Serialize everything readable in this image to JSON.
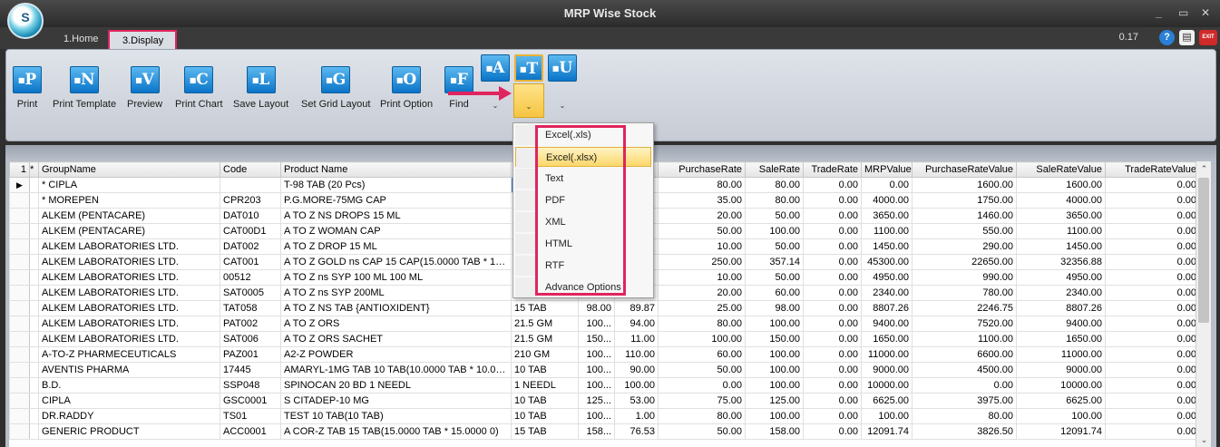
{
  "window": {
    "title": "MRP Wise Stock",
    "logo_text": "S",
    "version": "0.17",
    "minimize": "_",
    "restore": "▭",
    "close": "✕",
    "help_label": "?",
    "note_label": "▤",
    "exit_label": "EXIT"
  },
  "tabs": [
    {
      "label": "1.Home"
    },
    {
      "label": "3.Display"
    }
  ],
  "ribbon": {
    "buttons": [
      {
        "letter": "P",
        "label": "Print"
      },
      {
        "letter": "N",
        "label": "Print Template"
      },
      {
        "letter": "V",
        "label": "Preview"
      },
      {
        "letter": "C",
        "label": "Print Chart"
      },
      {
        "letter": "L",
        "label": "Save Layout"
      },
      {
        "letter": "G",
        "label": "Set Grid Layout"
      },
      {
        "letter": "O",
        "label": "Print Option"
      },
      {
        "letter": "F",
        "label": "Find"
      }
    ],
    "split_buttons": [
      {
        "letter": "A",
        "drop": "⌄"
      },
      {
        "letter": "T",
        "drop": "⌄"
      },
      {
        "letter": "U",
        "drop": "⌄"
      }
    ],
    "icon_small": "■"
  },
  "export_menu": {
    "items": [
      "Excel(.xls)",
      "Excel(.xlsx)",
      "Text",
      "PDF",
      "XML",
      "HTML",
      "RTF",
      "Advance Options"
    ]
  },
  "grid": {
    "row_indicator_header": "1",
    "star_header": "*",
    "current_row_marker": "▶",
    "columns": [
      "GroupName",
      "Code",
      "Product Name",
      "",
      "",
      "",
      "PurchaseRate",
      "SaleRate",
      "TradeRate",
      "MRPValue",
      "PurchaseRateValue",
      "SaleRateValue",
      "TradeRateValue"
    ],
    "rows": [
      [
        "* CIPLA",
        "",
        "T-98 TAB (20 Pcs)",
        "",
        "",
        "",
        "80.00",
        "80.00",
        "0.00",
        "0.00",
        "1600.00",
        "1600.00",
        "0.00"
      ],
      [
        "* MOREPEN",
        "CPR203",
        "P.G.MORE-75MG CAP",
        "",
        "",
        "",
        "35.00",
        "80.00",
        "0.00",
        "4000.00",
        "1750.00",
        "4000.00",
        "0.00"
      ],
      [
        "ALKEM (PENTACARE)",
        "DAT010",
        "A TO Z NS DROPS 15 ML",
        "",
        "",
        "",
        "20.00",
        "50.00",
        "0.00",
        "3650.00",
        "1460.00",
        "3650.00",
        "0.00"
      ],
      [
        "ALKEM (PENTACARE)",
        "CAT00D1",
        "A TO Z WOMAN CAP",
        "",
        "",
        "",
        "50.00",
        "100.00",
        "0.00",
        "1100.00",
        "550.00",
        "1100.00",
        "0.00"
      ],
      [
        "ALKEM LABORATORIES LTD.",
        "DAT002",
        "A TO Z DROP 15 ML",
        "",
        "",
        "",
        "10.00",
        "50.00",
        "0.00",
        "1450.00",
        "290.00",
        "1450.00",
        "0.00"
      ],
      [
        "ALKEM LABORATORIES LTD.",
        "CAT001",
        "A TO Z GOLD ns CAP 15 CAP(15.0000 TAB * 15....",
        "",
        "",
        "",
        "250.00",
        "357.14",
        "0.00",
        "45300.00",
        "22650.00",
        "32356.88",
        "0.00"
      ],
      [
        "ALKEM LABORATORIES LTD.",
        "00512",
        "A TO Z ns SYP 100 ML 100 ML",
        "",
        "",
        "",
        "10.00",
        "50.00",
        "0.00",
        "4950.00",
        "990.00",
        "4950.00",
        "0.00"
      ],
      [
        "ALKEM LABORATORIES LTD.",
        "SAT0005",
        "A TO Z ns SYP 200ML",
        "",
        "",
        "",
        "20.00",
        "60.00",
        "0.00",
        "2340.00",
        "780.00",
        "2340.00",
        "0.00"
      ],
      [
        "ALKEM LABORATORIES LTD.",
        "TAT058",
        "A TO Z NS TAB {ANTIOXIDENT}",
        "15 TAB",
        "98.00",
        "89.87",
        "25.00",
        "98.00",
        "0.00",
        "8807.26",
        "2246.75",
        "8807.26",
        "0.00"
      ],
      [
        "ALKEM LABORATORIES LTD.",
        "PAT002",
        "A TO Z ORS",
        "21.5 GM",
        "100...",
        "94.00",
        "80.00",
        "100.00",
        "0.00",
        "9400.00",
        "7520.00",
        "9400.00",
        "0.00"
      ],
      [
        "ALKEM LABORATORIES LTD.",
        "SAT006",
        "A TO Z ORS SACHET",
        "21.5 GM",
        "150...",
        "11.00",
        "100.00",
        "150.00",
        "0.00",
        "1650.00",
        "1100.00",
        "1650.00",
        "0.00"
      ],
      [
        "A-TO-Z PHARMECEUTICALS",
        "PAZ001",
        "A2-Z POWDER",
        "210 GM",
        "100...",
        "110.00",
        "60.00",
        "100.00",
        "0.00",
        "11000.00",
        "6600.00",
        "11000.00",
        "0.00"
      ],
      [
        "AVENTIS PHARMA",
        "17445",
        "AMARYL-1MG TAB 10 TAB(10.0000 TAB * 10.00...",
        "10 TAB",
        "100...",
        "90.00",
        "50.00",
        "100.00",
        "0.00",
        "9000.00",
        "4500.00",
        "9000.00",
        "0.00"
      ],
      [
        "B.D.",
        "SSP048",
        "SPINOCAN 20 BD 1 NEEDL",
        "1 NEEDL",
        "100...",
        "100.00",
        "0.00",
        "100.00",
        "0.00",
        "10000.00",
        "0.00",
        "10000.00",
        "0.00"
      ],
      [
        "CIPLA",
        "GSC0001",
        "S CITADEP-10 MG",
        "10 TAB",
        "125...",
        "53.00",
        "75.00",
        "125.00",
        "0.00",
        "6625.00",
        "3975.00",
        "6625.00",
        "0.00"
      ],
      [
        "DR.RADDY",
        "TS01",
        "TEST 10 TAB(10 TAB)",
        "10 TAB",
        "100...",
        "1.00",
        "80.00",
        "100.00",
        "0.00",
        "100.00",
        "80.00",
        "100.00",
        "0.00"
      ],
      [
        "GENERIC PRODUCT",
        "ACC0001",
        "A COR-Z TAB 15 TAB(15.0000 TAB * 15.0000 0)",
        "15 TAB",
        "158...",
        "76.53",
        "50.00",
        "158.00",
        "0.00",
        "12091.74",
        "3826.50",
        "12091.74",
        "0.00"
      ]
    ],
    "scroll_up": "⌃",
    "scroll_down": "⌄"
  }
}
